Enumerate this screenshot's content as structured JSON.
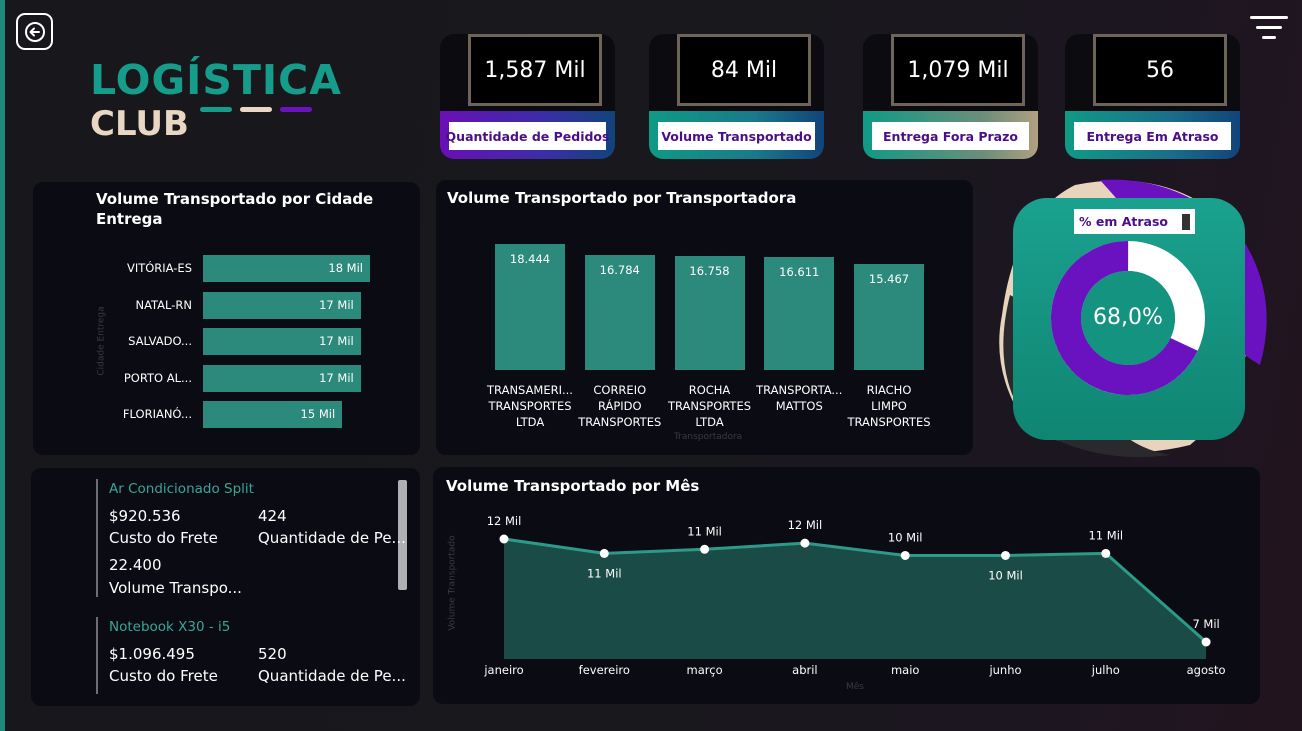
{
  "brand": {
    "line1": "LOGÍSTICA",
    "line2": "CLUB"
  },
  "kpis": [
    {
      "value": "1,587 Mil",
      "label": "Quantidade de Pedidos",
      "accent": "#6a0fb5"
    },
    {
      "value": "84 Mil",
      "label": "Volume Transportado",
      "accent": "#0f9a86"
    },
    {
      "value": "1,079 Mil",
      "label": "Entrega Fora Prazo",
      "accent": "#0f9a86"
    },
    {
      "value": "56",
      "label": "Entrega Em Atraso",
      "accent": "#0f9a86"
    }
  ],
  "city_chart": {
    "title": "Volume Transportado por Cidade Entrega",
    "axis_label": "Cidade Entrega",
    "chart_data": {
      "type": "bar",
      "orientation": "horizontal",
      "categories": [
        "VITÓRIA-ES",
        "NATAL-RN",
        "SALVADO...",
        "PORTO AL...",
        "FLORIANÓ..."
      ],
      "values": [
        18,
        17,
        17,
        17,
        15
      ],
      "value_labels": [
        "18 Mil",
        "17 Mil",
        "17 Mil",
        "17 Mil",
        "15 Mil"
      ],
      "unit": "Mil"
    }
  },
  "carrier_chart": {
    "title": "Volume Transportado por Transportadora",
    "xlabel": "Transportadora",
    "chart_data": {
      "type": "bar",
      "categories": [
        [
          "TRANSAMERI...",
          "TRANSPORTES",
          "LTDA"
        ],
        [
          "CORREIO",
          "RÁPIDO",
          "TRANSPORTES"
        ],
        [
          "ROCHA",
          "TRANSPORTES",
          "LTDA"
        ],
        [
          "TRANSPORTA...",
          "MATTOS"
        ],
        [
          "RIACHO",
          "LIMPO",
          "TRANSPORTES"
        ]
      ],
      "values": [
        18444,
        16784,
        16758,
        16611,
        15467
      ],
      "value_labels": [
        "18.444",
        "16.784",
        "16.758",
        "16.611",
        "15.467"
      ]
    }
  },
  "donut": {
    "label": "% em Atraso",
    "center": "68,0%",
    "chart_data": {
      "type": "pie",
      "series": [
        {
          "values": [
            0.68,
            0.32
          ]
        }
      ]
    },
    "colors": {
      "filled": "#6a12c0",
      "rest": "#ffffff"
    }
  },
  "products": [
    {
      "name": "Ar Condicionado Split",
      "freight_value": "$920.536",
      "freight_label": "Custo do Frete",
      "orders_value": "424",
      "orders_label": "Quantidade de Pe...",
      "volume_value": "22.400",
      "volume_label": "Volume Transpo..."
    },
    {
      "name": "Notebook X30 - i5",
      "freight_value": "$1.096.495",
      "freight_label": "Custo do Frete",
      "orders_value": "520",
      "orders_label": "Quantidade de Pe..."
    }
  ],
  "month_chart": {
    "title": "Volume Transportado por Mês",
    "xlabel": "Mês",
    "ylabel": "Volume Transportado",
    "chart_data": {
      "type": "area",
      "categories": [
        "janeiro",
        "fevereiro",
        "março",
        "abril",
        "maio",
        "junho",
        "julho",
        "agosto"
      ],
      "values": [
        11.9,
        11.2,
        11.4,
        11.7,
        11.1,
        11.1,
        11.2,
        6.9
      ],
      "value_labels": [
        "12 Mil",
        "11 Mil",
        "11 Mil",
        "12 Mil",
        "10 Mil",
        "10 Mil",
        "11 Mil",
        "7 Mil"
      ]
    }
  }
}
